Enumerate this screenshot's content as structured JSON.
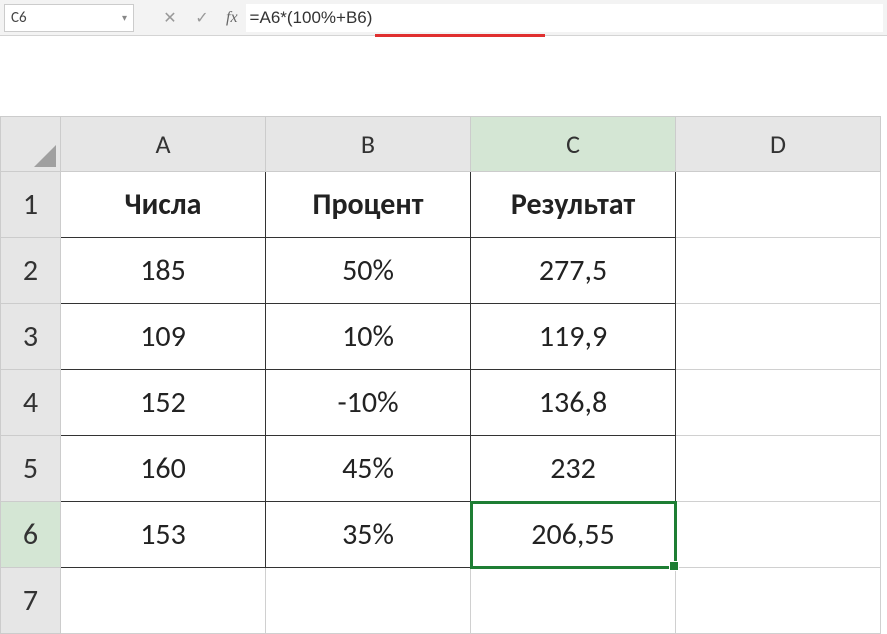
{
  "nameBox": "C6",
  "formula": "=A6*(100%+B6)",
  "columns": [
    "A",
    "B",
    "C",
    "D"
  ],
  "rows": [
    "1",
    "2",
    "3",
    "4",
    "5",
    "6",
    "7"
  ],
  "activeCol": "C",
  "activeRow": "6",
  "headers": {
    "A": "Числа",
    "B": "Процент",
    "C": "Результат"
  },
  "data": [
    {
      "A": "185",
      "B": "50%",
      "C": "277,5"
    },
    {
      "A": "109",
      "B": "10%",
      "C": "119,9"
    },
    {
      "A": "152",
      "B": "-10%",
      "C": "136,8"
    },
    {
      "A": "160",
      "B": "45%",
      "C": "232"
    },
    {
      "A": "153",
      "B": "35%",
      "C": "206,55"
    }
  ],
  "icons": {
    "cancel": "✕",
    "enter": "✓",
    "fx": "fx",
    "dropdown": "▾"
  }
}
